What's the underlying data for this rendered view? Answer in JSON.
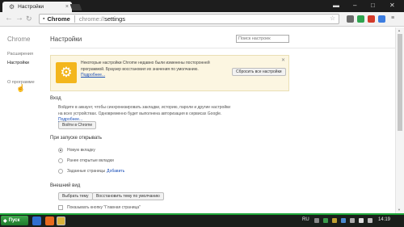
{
  "browser": {
    "tab_title": "Настройки",
    "omnibox_scheme": "Chrome",
    "omnibox_url_prefix": "chrome://",
    "omnibox_url_path": "settings"
  },
  "leftnav": {
    "brand": "Chrome",
    "items": [
      {
        "label": "Расширения"
      },
      {
        "label": "Настройки"
      },
      {
        "label": "О программе"
      }
    ]
  },
  "page": {
    "title": "Настройки",
    "search_placeholder": "Поиск настроек"
  },
  "notice": {
    "text": "Некоторые настройки Chrome недавно были изменены посторонней программой. Браузер восстановил их значения по умолчанию.",
    "link": "Подробнее...",
    "button": "Сбросить все настройки"
  },
  "signin": {
    "heading": "Вход",
    "text": "Войдите в аккаунт, чтобы синхронизировать закладки, историю, пароли и другие настройки на всех устройствах. Одновременно будет выполнена авторизация в сервисах Google.",
    "link": "Подробнее...",
    "button": "Войти в Chrome"
  },
  "startup": {
    "heading": "При запуске открывать",
    "options": [
      {
        "label": "Новую вкладку",
        "selected": true
      },
      {
        "label": "Ранее открытые вкладки",
        "selected": false
      },
      {
        "label": "Заданные страницы",
        "selected": false
      }
    ],
    "add_link": "Добавить"
  },
  "appearance": {
    "heading": "Внешний вид",
    "choose_theme": "Выбрать тему",
    "reset_theme": "Восстановить тему по умолчанию",
    "home_checkbox": "Показывать кнопку \"Главная страница\""
  },
  "taskbar": {
    "start_label": "Пуск",
    "lang": "RU",
    "time": "14:19"
  },
  "colors": {
    "accent_green": "#1fa83a",
    "warning_yellow": "#f3b61d",
    "link_blue": "#1a4fb8"
  }
}
